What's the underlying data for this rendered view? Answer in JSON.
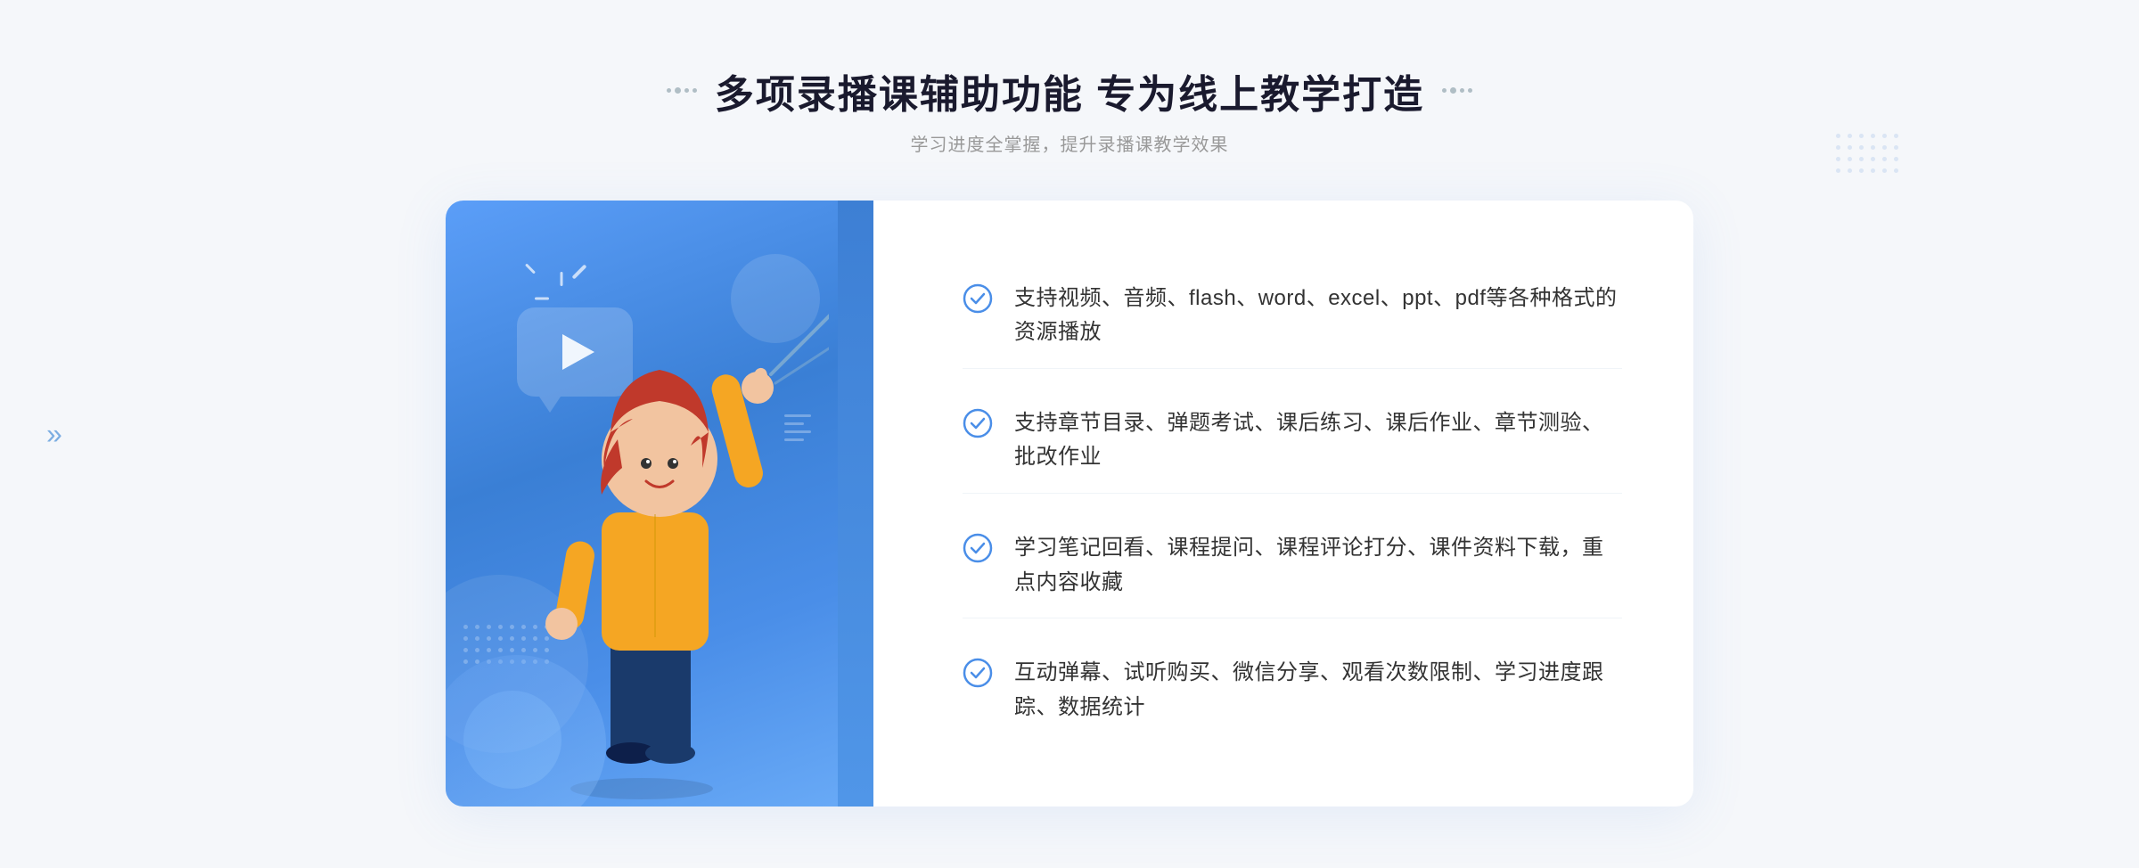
{
  "page": {
    "background": "#f5f7fa"
  },
  "header": {
    "title": "多项录播课辅助功能 专为线上教学打造",
    "subtitle": "学习进度全掌握，提升录播课教学效果"
  },
  "features": [
    {
      "id": "feature-1",
      "text": "支持视频、音频、flash、word、excel、ppt、pdf等各种格式的资源播放"
    },
    {
      "id": "feature-2",
      "text": "支持章节目录、弹题考试、课后练习、课后作业、章节测验、批改作业"
    },
    {
      "id": "feature-3",
      "text": "学习笔记回看、课程提问、课程评论打分、课件资料下载，重点内容收藏"
    },
    {
      "id": "feature-4",
      "text": "互动弹幕、试听购买、微信分享、观看次数限制、学习进度跟踪、数据统计"
    }
  ],
  "icons": {
    "check": "check-circle-icon",
    "play": "play-icon",
    "chevron_left": "«",
    "chevron_right": "»"
  },
  "colors": {
    "primary": "#4a8ee8",
    "primary_dark": "#3a7fd5",
    "primary_light": "#6aabf7",
    "text_dark": "#1a1a2e",
    "text_body": "#333333",
    "text_gray": "#999999",
    "check_color": "#4a8ee8",
    "bg": "#f5f7fa",
    "white": "#ffffff"
  }
}
